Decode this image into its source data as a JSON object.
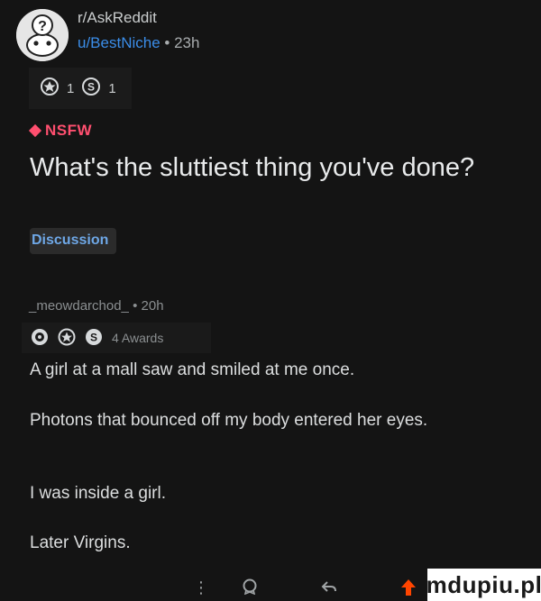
{
  "post": {
    "subreddit": "r/AskReddit",
    "author": "u/BestNiche",
    "separator": "•",
    "age": "23h",
    "awards": [
      {
        "icon": "gold-award-icon",
        "count": "1"
      },
      {
        "icon": "silver-award-icon",
        "count": "1"
      }
    ],
    "nsfw_label": "NSFW",
    "title": "What's the sluttiest thing you've done?",
    "flair": "Discussion"
  },
  "comment": {
    "author": "_meowdarchod_",
    "separator": "•",
    "age": "20h",
    "awards_label": "4 Awards",
    "lines": [
      "A girl at a mall saw and smiled at me once.",
      "Photons that bounced off my body entered her eyes.",
      "I was inside a girl.",
      "Later Virgins."
    ]
  },
  "bottom_bar": {
    "more_icon": "more-vertical-icon",
    "award_icon": "award-icon",
    "reply_icon": "reply-icon",
    "upvote_icon": "upvote-arrow-icon"
  },
  "watermark": "mdupiu.pl",
  "colors": {
    "background": "#141414",
    "nsfw": "#ff4f6f",
    "link": "#3b8de8",
    "upvote": "#ff4500"
  }
}
